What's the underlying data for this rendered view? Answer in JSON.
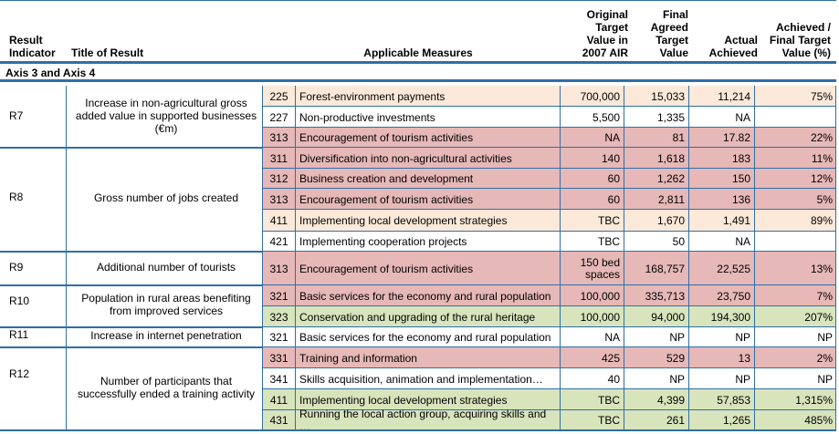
{
  "columns": {
    "result_indicator": "Result Indicator",
    "title": "Title of Result",
    "measures": "Applicable Measures",
    "original_target": "Original Target Value in 2007 AIR",
    "final_target": "Final Agreed Target Value",
    "actual": "Actual Achieved",
    "achieved_pct": "Achieved / Final Target Value (%)"
  },
  "section_title": "Axis 3 and Axis 4",
  "colors": {
    "peach": "#fde9d9",
    "pink": "#e6b8b7",
    "green": "#d8e4bc",
    "white": "#ffffff",
    "border": "#2f6fa7"
  },
  "groups": [
    {
      "id": "R7",
      "title": "Increase in non-agricultural gross added value in supported businesses (€m)"
    },
    {
      "id": "R8",
      "title": "Gross number of jobs created"
    },
    {
      "id": "R9",
      "title": "Additional number of tourists"
    },
    {
      "id": "R10",
      "title": "Population in rural areas benefiting from improved services"
    },
    {
      "id": "R11",
      "title": "Increase in internet penetration"
    },
    {
      "id": "R12",
      "title": "Number of participants that successfully ended a training activity"
    }
  ],
  "rows": [
    {
      "code": "225",
      "measure": "Forest-environment payments",
      "original": "700,000",
      "final": "15,033",
      "actual": "11,214",
      "pct": "75%",
      "color": "peach"
    },
    {
      "code": "227",
      "measure": "Non-productive investments",
      "original": "5,500",
      "final": "1,335",
      "actual": "NA",
      "pct": "",
      "color": "white"
    },
    {
      "code": "313",
      "measure": "Encouragement of tourism activities",
      "original": "NA",
      "final": "81",
      "actual": "17.82",
      "pct": "22%",
      "color": "pink"
    },
    {
      "code": "311",
      "measure": "Diversification into non-agricultural activities",
      "original": "140",
      "final": "1,618",
      "actual": "183",
      "pct": "11%",
      "color": "pink"
    },
    {
      "code": "312",
      "measure": "Business creation and development",
      "original": "60",
      "final": "1,262",
      "actual": "150",
      "pct": "12%",
      "color": "pink"
    },
    {
      "code": "313",
      "measure": "Encouragement of tourism activities",
      "original": "60",
      "final": "2,811",
      "actual": "136",
      "pct": "5%",
      "color": "pink"
    },
    {
      "code": "411",
      "measure": "Implementing local development strategies",
      "original": "TBC",
      "final": "1,670",
      "actual": "1,491",
      "pct": "89%",
      "color": "peach"
    },
    {
      "code": "421",
      "measure": "Implementing cooperation projects",
      "original": "TBC",
      "final": "50",
      "actual": "NA",
      "pct": "",
      "color": "white"
    },
    {
      "code": "313",
      "measure": "Encouragement of tourism activities",
      "original": "150 bed spaces",
      "final": "168,757",
      "actual": "22,525",
      "pct": "13%",
      "color": "pink"
    },
    {
      "code": "321",
      "measure": "Basic services for the economy and rural population",
      "original": "100,000",
      "final": "335,713",
      "actual": "23,750",
      "pct": "7%",
      "color": "pink"
    },
    {
      "code": "323",
      "measure": "Conservation and upgrading of the rural heritage",
      "original": "100,000",
      "final": "94,000",
      "actual": "194,300",
      "pct": "207%",
      "color": "green"
    },
    {
      "code": "321",
      "measure": "Basic services for the economy and rural population",
      "original": "NA",
      "final": "NP",
      "actual": "NP",
      "pct": "NP",
      "color": "white"
    },
    {
      "code": "331",
      "measure": "Training and information",
      "original": "425",
      "final": "529",
      "actual": "13",
      "pct": "2%",
      "color": "pink"
    },
    {
      "code": "341",
      "measure": "Skills acquisition, animation and implementation…",
      "original": "40",
      "final": "NP",
      "actual": "NP",
      "pct": "NP",
      "color": "white"
    },
    {
      "code": "411",
      "measure": "Implementing local development strategies",
      "original": "TBC",
      "final": "4,399",
      "actual": "57,853",
      "pct": "1,315%",
      "color": "green"
    },
    {
      "code": "431",
      "measure": "Running the local action group, acquiring skills and …",
      "original": "TBC",
      "final": "261",
      "actual": "1,265",
      "pct": "485%",
      "color": "green"
    }
  ]
}
